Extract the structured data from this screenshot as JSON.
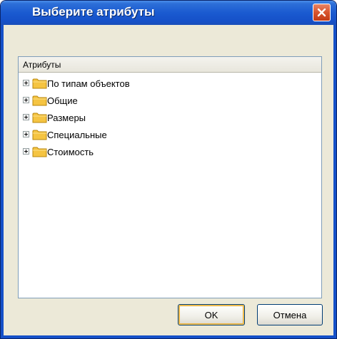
{
  "dialog": {
    "title": "Выберите атрибуты",
    "close_icon": "close-icon"
  },
  "panel": {
    "header": "Атрибуты"
  },
  "tree": {
    "items": [
      {
        "label": "По типам объектов",
        "icon": "folder-icon"
      },
      {
        "label": "Общие",
        "icon": "folder-icon"
      },
      {
        "label": "Размеры",
        "icon": "folder-icon"
      },
      {
        "label": "Специальные",
        "icon": "folder-icon"
      },
      {
        "label": "Стоимость",
        "icon": "folder-icon"
      }
    ]
  },
  "buttons": {
    "ok": "OK",
    "cancel": "Отмена"
  },
  "colors": {
    "titlebar": "#1a5ad0",
    "close_button": "#d8542e",
    "folder": "#f5c442"
  }
}
